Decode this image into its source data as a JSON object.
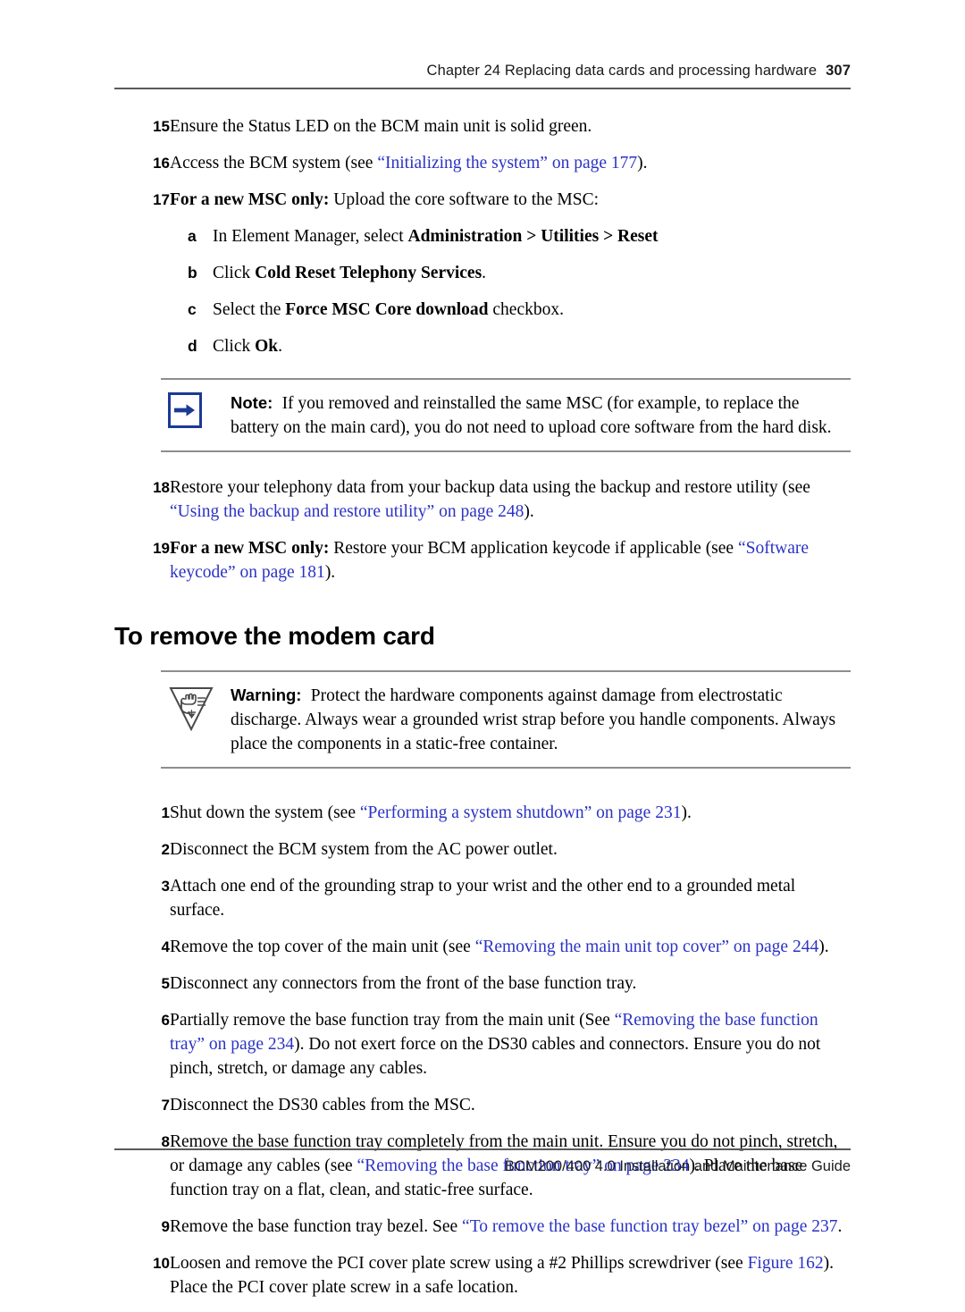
{
  "header": {
    "chapter": "Chapter 24  Replacing data cards and processing hardware",
    "page_number": "307"
  },
  "footer": {
    "guide_title": "BCM200/400 4.0 Installation and Maintenance Guide"
  },
  "colors": {
    "link": "#2b33c4",
    "rule": "#8d8d8d",
    "note_icon_border": "#1b3a95",
    "note_arrow": "#1b3a95"
  },
  "steps_top": [
    {
      "num": "15",
      "parts": [
        {
          "t": "Ensure the Status LED on the BCM main unit is solid green.",
          "style": "plain"
        }
      ]
    },
    {
      "num": "16",
      "parts": [
        {
          "t": "Access the BCM system (see ",
          "style": "plain"
        },
        {
          "t": "“Initializing the system” on page 177",
          "style": "link"
        },
        {
          "t": ").",
          "style": "plain"
        }
      ]
    },
    {
      "num": "17",
      "parts": [
        {
          "t": "For a new MSC only:",
          "style": "bold"
        },
        {
          "t": " Upload the core software to the MSC:",
          "style": "plain"
        }
      ]
    }
  ],
  "substeps": [
    {
      "letter": "a",
      "parts": [
        {
          "t": "In Element Manager, select ",
          "style": "plain"
        },
        {
          "t": "Administration > Utilities > Reset",
          "style": "bold"
        }
      ]
    },
    {
      "letter": "b",
      "parts": [
        {
          "t": "Click ",
          "style": "plain"
        },
        {
          "t": "Cold Reset Telephony Services",
          "style": "bold"
        },
        {
          "t": ".",
          "style": "plain"
        }
      ]
    },
    {
      "letter": "c",
      "parts": [
        {
          "t": "Select the ",
          "style": "plain"
        },
        {
          "t": "Force MSC Core download",
          "style": "bold"
        },
        {
          "t": " checkbox.",
          "style": "plain"
        }
      ]
    },
    {
      "letter": "d",
      "parts": [
        {
          "t": "Click ",
          "style": "plain"
        },
        {
          "t": "Ok",
          "style": "bold"
        },
        {
          "t": ".",
          "style": "plain"
        }
      ]
    }
  ],
  "note": {
    "icon": "right-arrow-icon",
    "label": "Note:",
    "text": "If you removed and reinstalled the same MSC (for example, to replace the battery on the main card), you do not need to upload core software from the hard disk."
  },
  "steps_after_note": [
    {
      "num": "18",
      "parts": [
        {
          "t": "Restore your telephony data from your backup data using the backup and restore utility (see ",
          "style": "plain"
        },
        {
          "t": "“Using the backup and restore utility” on page 248",
          "style": "link"
        },
        {
          "t": ").",
          "style": "plain"
        }
      ]
    },
    {
      "num": "19",
      "parts": [
        {
          "t": "For a new MSC only:",
          "style": "bold"
        },
        {
          "t": " Restore your BCM application keycode if applicable (see ",
          "style": "plain"
        },
        {
          "t": "“Software keycode” on page 181",
          "style": "link"
        },
        {
          "t": ").",
          "style": "plain"
        }
      ]
    }
  ],
  "section": {
    "heading": "To remove the modem card"
  },
  "warning": {
    "icon": "esd-warning-icon",
    "label": "Warning:",
    "text": "Protect the hardware components against damage from electrostatic discharge. Always wear a grounded wrist strap before you handle components. Always place the components in a static-free container."
  },
  "procedure_steps": [
    {
      "num": "1",
      "parts": [
        {
          "t": "Shut down the system (see ",
          "style": "plain"
        },
        {
          "t": "“Performing a system shutdown” on page 231",
          "style": "link"
        },
        {
          "t": ").",
          "style": "plain"
        }
      ]
    },
    {
      "num": "2",
      "parts": [
        {
          "t": "Disconnect the BCM system from the AC power outlet.",
          "style": "plain"
        }
      ]
    },
    {
      "num": "3",
      "parts": [
        {
          "t": "Attach one end of the grounding strap to your wrist and the other end to a grounded metal surface.",
          "style": "plain"
        }
      ]
    },
    {
      "num": "4",
      "parts": [
        {
          "t": "Remove the top cover of the main unit (see ",
          "style": "plain"
        },
        {
          "t": "“Removing the main unit top cover” on page 244",
          "style": "link"
        },
        {
          "t": ").",
          "style": "plain"
        }
      ]
    },
    {
      "num": "5",
      "parts": [
        {
          "t": "Disconnect any connectors from the front of the base function tray.",
          "style": "plain"
        }
      ]
    },
    {
      "num": "6",
      "parts": [
        {
          "t": "Partially remove the base function tray from the main unit (See ",
          "style": "plain"
        },
        {
          "t": "“Removing the base function tray” on page 234",
          "style": "link"
        },
        {
          "t": "). Do not exert force on the DS30 cables and connectors. Ensure you do not pinch, stretch, or damage any cables.",
          "style": "plain"
        }
      ]
    },
    {
      "num": "7",
      "parts": [
        {
          "t": "Disconnect the DS30 cables from the MSC.",
          "style": "plain"
        }
      ]
    },
    {
      "num": "8",
      "parts": [
        {
          "t": "Remove the base function tray completely from the main unit. Ensure you do not pinch, stretch, or damage any cables (see ",
          "style": "plain"
        },
        {
          "t": "“Removing the base function tray” on page 234",
          "style": "link"
        },
        {
          "t": "). Place the base function tray on a flat, clean, and static-free surface.",
          "style": "plain"
        }
      ]
    },
    {
      "num": "9",
      "parts": [
        {
          "t": "Remove the base function tray bezel. See ",
          "style": "plain"
        },
        {
          "t": "“To remove the base function tray bezel” on page 237",
          "style": "link"
        },
        {
          "t": ".",
          "style": "plain"
        }
      ]
    },
    {
      "num": "10",
      "parts": [
        {
          "t": "Loosen and remove the PCI cover plate screw using a #2 Phillips screwdriver (see ",
          "style": "plain"
        },
        {
          "t": "Figure 162",
          "style": "link"
        },
        {
          "t": "). Place the PCI cover plate screw in a safe location.",
          "style": "plain"
        }
      ]
    }
  ]
}
